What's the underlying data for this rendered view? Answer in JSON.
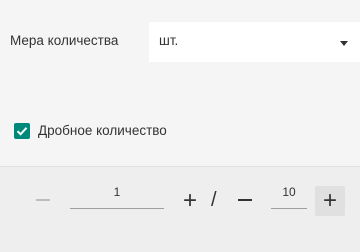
{
  "measure": {
    "label": "Мера количества",
    "selected": "шт."
  },
  "fraction": {
    "label": "Дробное количество",
    "checked": true
  },
  "quantity": {
    "numerator": "1",
    "separator": "/",
    "denominator": "10",
    "plus_symbol": "+"
  },
  "colors": {
    "accent": "#00897b",
    "panel": "#eeeeee"
  }
}
